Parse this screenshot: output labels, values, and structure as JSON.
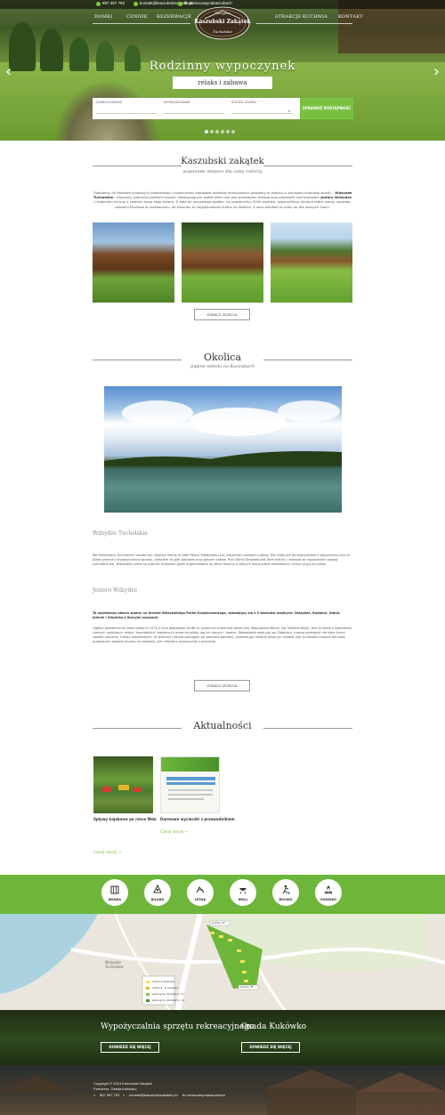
{
  "topbar": {
    "phone": "887 367 793",
    "email": "kontakt@kaszubskizakatek.pl",
    "facebook": "fb.me/wczasynakaszubach"
  },
  "nav": {
    "items": [
      "DOMKI",
      "CENNIK",
      "REZERWACJE",
      "ATRAKCJE",
      "KUCHNIA",
      "KONTAKT"
    ]
  },
  "logo": {
    "top": "Wdzydze",
    "middle": "Kaszubski Zakątek",
    "bottom": "Tucholskie"
  },
  "hero": {
    "title": "Rodzinny wypoczynek",
    "subtitle": "relaks i zabawa"
  },
  "booking": {
    "field1": "ZAMELDOWANIE",
    "field2": "WYMELDOWANIE",
    "field3": "RODZAJ DOMKU",
    "button": "SPRAWDŹ DOSTĘPNOŚĆ"
  },
  "about": {
    "title": "Kaszubski zakątek",
    "subtitle": "wspaniałe miejsce dla całej rodziny",
    "text_parts": [
      "Oddajemy do Państwa dyspozycji komfortowy i nowoczesny kompleks domków letniskowych położony w miejscu z zaciszem urokliwej wioski – ",
      "Wdzydze Tucholskie",
      " - otoczony pięknymi polskimi lasami. Nawiązującym wokół wiem wsi jest wzniesione malownicze położenie nad brzegiem ",
      "jeziora Wdzydze",
      " z widokiem na trzy z siedmiu wysp tego jeziora. Z dala od miejskiego zgiełku, na powierzchni 5000 metrów, stworzyliśmy miejsce które mamy nadzieję, uświetni Państwa w przekonaniu, że Kaszuby to najpiękniejsza kraina na świecie, a nasz ośrodek to mały raj dla naszych Gości."
    ],
    "button": "ZOBACZ ZDJĘCIA"
  },
  "okolica": {
    "title": "Okolica",
    "subtitle": "piękne widoki na Kaszubach",
    "sub1": "Wdzydze Tucholskie",
    "text1": "We Wdzydzach Tucholskich urodził się i tworzył dramy w całej Polsce Władysław Lica, kaszubski rzeźbiarz ludowy. Dla chętnych do skorzystania z wypoczynku jest to plaża gminna z wypożyczalnią sprzętu, boiskiem do gier plażowej oraz placem zabaw. Przy Domu Strażaka jest Dom Kultury i stanowi ze nazywaniem zapasy kulturalne wsi. Wdzydzkie plaże są również miejscem gdzie organizowane są letnie festyny w których biorą udział mieszkańcy i liczne grupy turystów.",
    "sub2": "Jezioro Wdzydze",
    "text2_bold": "To największy akwen wodny na terenie Wdzydzkiego Parku Krajobrazowego, składający się z 5 basenów wodnych: Wdzydze, Radolne, Gołuń, Jelenie i Słupinko z licznymi wyspami.",
    "text3": "Ogólna powierzchnia lustra wody to 1570,2 ha o głębokości do 68 m. Jezioro to znane jest także jako 'Kaszubskie Morze' lub 'Wielkie Wody'. Jest to jedno z najbardziej znanych urokliwych miejsc 'kaszubskich' uważanych przez turystów, wg ich danych i legend. Równolegle wędrując po Zaborach, można podziwiać nie tylko liczne zakątki uroczysk, miejsc zabytkowych. W okolicach jeziora posługuje się wieloma gwarami, przekazując historię dawnych czasów. Jest to idealne miejsce dla osób pragnących spędzić wczasy na rekreacji, jak i aktywny wypoczynek z przyrodą.",
    "button": "ZOBACZ ZDJĘCIA"
  },
  "news": {
    "title": "Aktualności",
    "item1_title": "Spływy kajakowe po rzece Wda",
    "item2_title": "Darmowe wycieczki z przewodnikiem",
    "readmore": "Czytaj więcej",
    "readmore_all": "Czytaj więcej"
  },
  "amenities": [
    "BRAMA",
    "BILARD",
    "LEŻAK",
    "GRILL",
    "BOISKO",
    "OGNISKO"
  ],
  "map": {
    "village": "Wdzydze Tucholskie",
    "gate_a": "brama \"A\"",
    "gate_b": "brama \"B\"",
    "legend": [
      "domki 4-osobowe",
      "domki 4 - 6 osobowe",
      "parking do domków 1 - 6",
      "parking do domków 9 - 11"
    ]
  },
  "cta": {
    "left_title": "Wypożyczalnia sprzętu rekreacyjnego",
    "left_button": "DOWIEDZ SIĘ WIĘCEJ",
    "right_title": "Osada Kukówko",
    "right_button": "DOWIEDZ SIĘ WIĘCEJ"
  },
  "footer": {
    "copyright": "Copyright © 2014 Kaszubski Zakątek",
    "partner": "Partnerzy: Osada Kukówko",
    "phone": "887 367 793",
    "email": "kontakt@kaszubskizakatek.pl",
    "facebook": "fb.me/wczasynakaszubach"
  },
  "colors": {
    "accent_green": "#7ac142",
    "bar_green": "#6db63a",
    "text": "#333333"
  }
}
